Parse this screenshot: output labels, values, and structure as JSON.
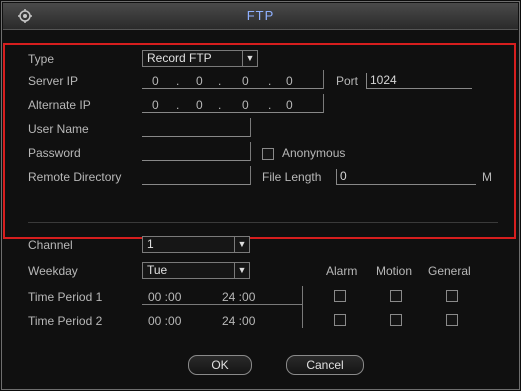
{
  "window": {
    "title": "FTP"
  },
  "form": {
    "type_label": "Type",
    "type_value": "Record FTP",
    "server_ip_label": "Server IP",
    "server_ip": [
      "0",
      "0",
      "0",
      "0"
    ],
    "port_label": "Port",
    "port_value": "1024",
    "alternate_ip_label": "Alternate IP",
    "alternate_ip": [
      "0",
      "0",
      "0",
      "0"
    ],
    "username_label": "User Name",
    "username_value": "",
    "password_label": "Password",
    "password_value": "",
    "anonymous_label": "Anonymous",
    "remote_dir_label": "Remote Directory",
    "remote_dir_value": "",
    "file_length_label": "File Length",
    "file_length_value": "0",
    "file_length_unit": "M"
  },
  "schedule": {
    "channel_label": "Channel",
    "channel_value": "1",
    "weekday_label": "Weekday",
    "weekday_value": "Tue",
    "alarm_label": "Alarm",
    "motion_label": "Motion",
    "general_label": "General",
    "period1_label": "Time Period 1",
    "period1_start": "00 :00",
    "period1_end": "24 :00",
    "period2_label": "Time Period 2",
    "period2_start": "00 :00",
    "period2_end": "24 :00"
  },
  "buttons": {
    "ok": "OK",
    "cancel": "Cancel"
  }
}
